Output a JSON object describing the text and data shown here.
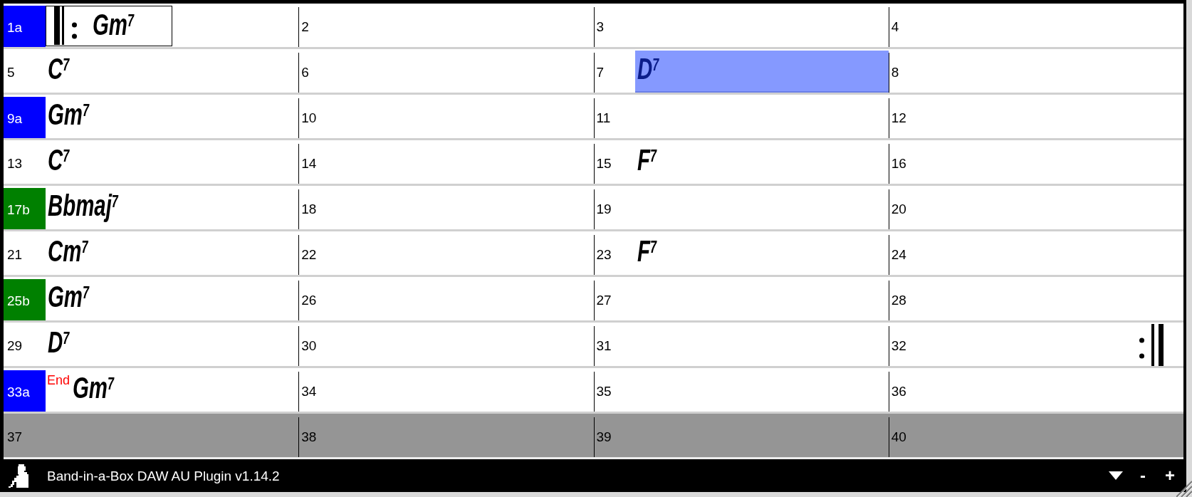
{
  "rows": [
    {
      "past_end": false,
      "bars": [
        {
          "number": "1a",
          "color": "#0000ff",
          "selected": true,
          "highlighted": false,
          "repeat_start": true,
          "repeat_end": false,
          "chord": "Gm$^{7}$"
        },
        {
          "number": "2",
          "selected": false,
          "highlighted": false,
          "repeat_start": false,
          "repeat_end": false
        },
        {
          "number": "3",
          "selected": false,
          "highlighted": false,
          "repeat_start": false,
          "repeat_end": false
        },
        {
          "number": "4",
          "selected": false,
          "highlighted": false,
          "repeat_start": false,
          "repeat_end": false
        }
      ]
    },
    {
      "past_end": false,
      "bars": [
        {
          "number": "5",
          "selected": false,
          "highlighted": false,
          "repeat_start": false,
          "repeat_end": false,
          "chord": "C$^{7}$"
        },
        {
          "number": "6",
          "selected": false,
          "highlighted": false,
          "repeat_start": false,
          "repeat_end": false
        },
        {
          "number": "7",
          "selected": false,
          "highlighted": true,
          "repeat_start": false,
          "repeat_end": false,
          "chord": "D$^{7}$"
        },
        {
          "number": "8",
          "selected": false,
          "highlighted": false,
          "repeat_start": false,
          "repeat_end": false
        }
      ]
    },
    {
      "past_end": false,
      "bars": [
        {
          "number": "9a",
          "color": "#0000ff",
          "selected": false,
          "highlighted": false,
          "repeat_start": false,
          "repeat_end": false,
          "chord": "Gm$^{7}$"
        },
        {
          "number": "10",
          "selected": false,
          "highlighted": false,
          "repeat_start": false,
          "repeat_end": false
        },
        {
          "number": "11",
          "selected": false,
          "highlighted": false,
          "repeat_start": false,
          "repeat_end": false
        },
        {
          "number": "12",
          "selected": false,
          "highlighted": false,
          "repeat_start": false,
          "repeat_end": false
        }
      ]
    },
    {
      "past_end": false,
      "bars": [
        {
          "number": "13",
          "selected": false,
          "highlighted": false,
          "repeat_start": false,
          "repeat_end": false,
          "chord": "C$^{7}$"
        },
        {
          "number": "14",
          "selected": false,
          "highlighted": false,
          "repeat_start": false,
          "repeat_end": false
        },
        {
          "number": "15",
          "selected": false,
          "highlighted": false,
          "repeat_start": false,
          "repeat_end": false,
          "chord": "F$^{7}$"
        },
        {
          "number": "16",
          "selected": false,
          "highlighted": false,
          "repeat_start": false,
          "repeat_end": false
        }
      ]
    },
    {
      "past_end": false,
      "bars": [
        {
          "number": "17b",
          "color": "#008000",
          "selected": false,
          "highlighted": false,
          "repeat_start": false,
          "repeat_end": false,
          "chord": "Bbmaj$^{7}$"
        },
        {
          "number": "18",
          "selected": false,
          "highlighted": false,
          "repeat_start": false,
          "repeat_end": false
        },
        {
          "number": "19",
          "selected": false,
          "highlighted": false,
          "repeat_start": false,
          "repeat_end": false
        },
        {
          "number": "20",
          "selected": false,
          "highlighted": false,
          "repeat_start": false,
          "repeat_end": false
        }
      ]
    },
    {
      "past_end": false,
      "bars": [
        {
          "number": "21",
          "selected": false,
          "highlighted": false,
          "repeat_start": false,
          "repeat_end": false,
          "chord": "Cm$^{7}$"
        },
        {
          "number": "22",
          "selected": false,
          "highlighted": false,
          "repeat_start": false,
          "repeat_end": false
        },
        {
          "number": "23",
          "selected": false,
          "highlighted": false,
          "repeat_start": false,
          "repeat_end": false,
          "chord": "F$^{7}$"
        },
        {
          "number": "24",
          "selected": false,
          "highlighted": false,
          "repeat_start": false,
          "repeat_end": false
        }
      ]
    },
    {
      "past_end": false,
      "bars": [
        {
          "number": "25b",
          "color": "#008000",
          "selected": false,
          "highlighted": false,
          "repeat_start": false,
          "repeat_end": false,
          "chord": "Gm$^{7}$"
        },
        {
          "number": "26",
          "selected": false,
          "highlighted": false,
          "repeat_start": false,
          "repeat_end": false
        },
        {
          "number": "27",
          "selected": false,
          "highlighted": false,
          "repeat_start": false,
          "repeat_end": false
        },
        {
          "number": "28",
          "selected": false,
          "highlighted": false,
          "repeat_start": false,
          "repeat_end": false
        }
      ]
    },
    {
      "past_end": false,
      "bars": [
        {
          "number": "29",
          "selected": false,
          "highlighted": false,
          "repeat_start": false,
          "repeat_end": false,
          "chord": "D$^{7}$"
        },
        {
          "number": "30",
          "selected": false,
          "highlighted": false,
          "repeat_start": false,
          "repeat_end": false
        },
        {
          "number": "31",
          "selected": false,
          "highlighted": false,
          "repeat_start": false,
          "repeat_end": false
        },
        {
          "number": "32",
          "selected": false,
          "highlighted": false,
          "repeat_start": false,
          "repeat_end": true
        }
      ]
    },
    {
      "past_end": false,
      "bars": [
        {
          "number": "33a",
          "color": "#0000ff",
          "selected": false,
          "highlighted": false,
          "repeat_start": false,
          "repeat_end": false,
          "marker": "End",
          "chord": "Gm$^{7}$"
        },
        {
          "number": "34",
          "selected": false,
          "highlighted": false,
          "repeat_start": false,
          "repeat_end": false
        },
        {
          "number": "35",
          "selected": false,
          "highlighted": false,
          "repeat_start": false,
          "repeat_end": false
        },
        {
          "number": "36",
          "selected": false,
          "highlighted": false,
          "repeat_start": false,
          "repeat_end": false
        }
      ]
    },
    {
      "past_end": true,
      "bars": [
        {
          "number": "37",
          "selected": false,
          "highlighted": false,
          "repeat_start": false,
          "repeat_end": false
        },
        {
          "number": "38",
          "selected": false,
          "highlighted": false,
          "repeat_start": false,
          "repeat_end": false
        },
        {
          "number": "39",
          "selected": false,
          "highlighted": false,
          "repeat_start": false,
          "repeat_end": false
        },
        {
          "number": "40",
          "selected": false,
          "highlighted": false,
          "repeat_start": false,
          "repeat_end": false
        }
      ]
    }
  ],
  "status_bar": {
    "title": "Band-in-a-Box DAW AU Plugin v1.14.2",
    "buttons": [
      {
        "kind": "dropdown"
      },
      {
        "kind": "text",
        "label": "-"
      },
      {
        "kind": "text",
        "label": "+"
      }
    ]
  }
}
